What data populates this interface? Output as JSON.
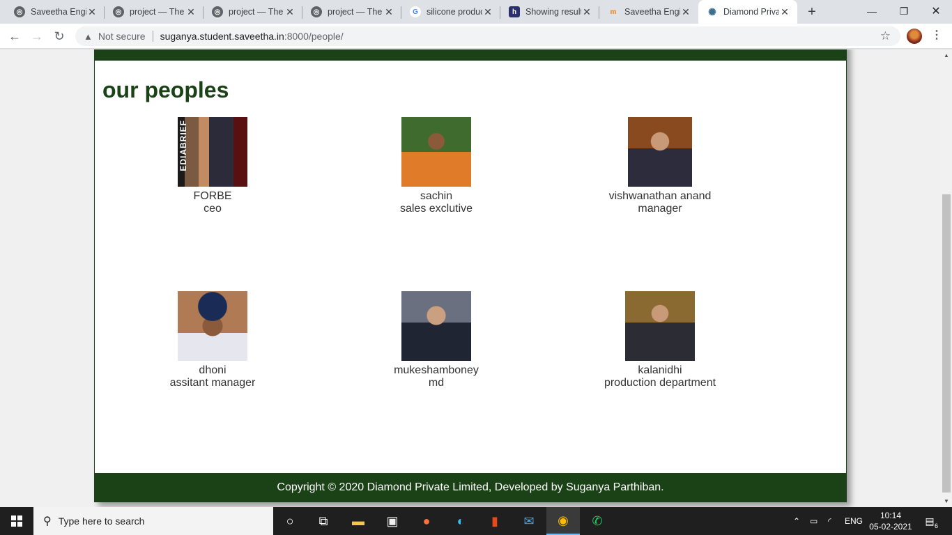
{
  "browser": {
    "tabs": [
      {
        "title": "Saveetha Engin",
        "favicon": "globe-icon",
        "active": false
      },
      {
        "title": "project — The",
        "favicon": "globe-icon",
        "active": false
      },
      {
        "title": "project — The",
        "favicon": "globe-icon",
        "active": false
      },
      {
        "title": "project — The",
        "favicon": "globe-icon",
        "active": false
      },
      {
        "title": "silicone produc",
        "favicon": "google-icon",
        "active": false
      },
      {
        "title": "Showing result",
        "favicon": "site-icon",
        "active": false
      },
      {
        "title": "Saveetha Engin",
        "favicon": "moodle-icon",
        "active": false
      },
      {
        "title": "Diamond Priva",
        "favicon": "settings-icon",
        "active": true
      }
    ],
    "security_label": "Not secure",
    "url_host": "suganya.student.saveetha.in",
    "url_path": ":8000/people/"
  },
  "page": {
    "heading": "our peoples",
    "people": [
      {
        "name": "FORBE",
        "role": "ceo",
        "photo_text": "EDIABRIEF"
      },
      {
        "name": "sachin",
        "role": "sales exclutive"
      },
      {
        "name": "vishwanathan anand",
        "role": "manager"
      },
      {
        "name": "dhoni",
        "role": "assitant manager"
      },
      {
        "name": "mukeshamboney",
        "role": "md"
      },
      {
        "name": "kalanidhi",
        "role": "production department"
      }
    ],
    "footer": "Copyright © 2020 Diamond Private Limited, Developed by Suganya Parthiban."
  },
  "taskbar": {
    "search_placeholder": "Type here to search",
    "language": "ENG",
    "time": "10:14",
    "date": "05-02-2021",
    "notification_count": "6"
  },
  "colors": {
    "brand_green": "#1b4217",
    "footer_text": "#ffffff"
  }
}
